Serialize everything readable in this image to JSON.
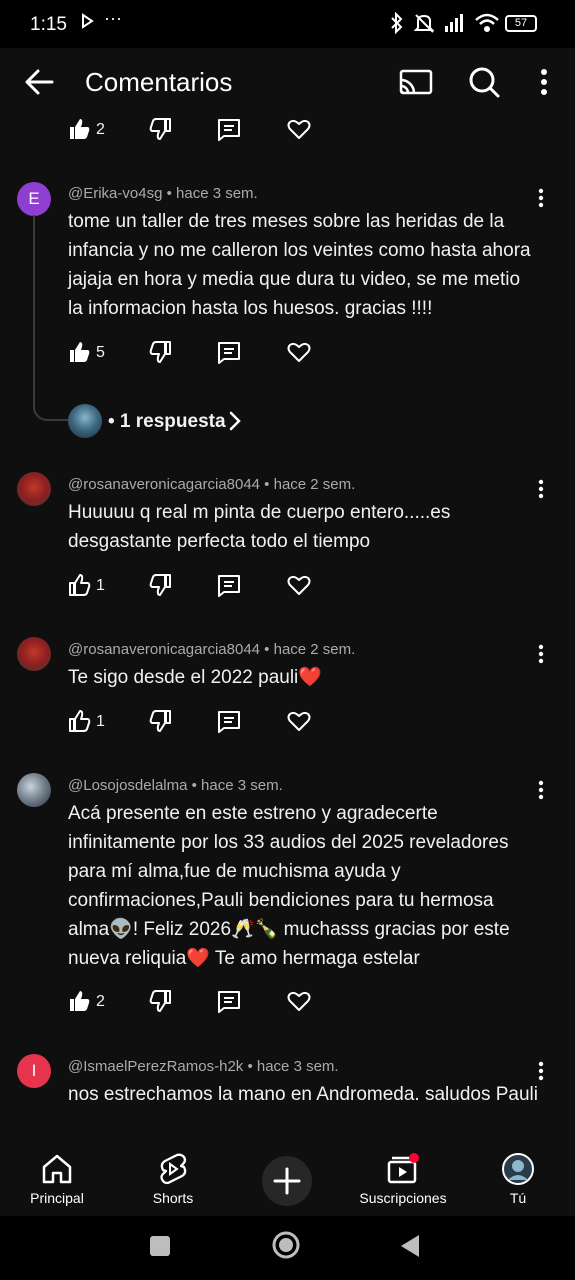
{
  "status_bar": {
    "time": "1:15",
    "battery": "57"
  },
  "header": {
    "title": "Comentarios"
  },
  "top_actions": {
    "likes": "2"
  },
  "comments": [
    {
      "avatar_letter": "E",
      "avatar_color": "#8e3fd1",
      "meta": "@Erika-vo4sg • hace 3 sem.",
      "text": "tome un taller de tres meses sobre las heridas de la infancia y  no me calleron los veintes como hasta ahora jajaja  en hora y media que dura tu video, se me metio la informacion hasta los huesos. gracias !!!!",
      "likes": "5",
      "replies_label": "• 1 respuesta"
    },
    {
      "avatar_letter": "",
      "avatar_color": "#b02a2a",
      "meta": "@rosanaveronicagarcia8044 • hace 2 sem.",
      "text": "Huuuuu q real m pinta de cuerpo entero.....es desgastante perfecta todo el tiempo",
      "likes": "1"
    },
    {
      "avatar_letter": "",
      "avatar_color": "#b02a2a",
      "meta": "@rosanaveronicagarcia8044 • hace 2 sem.",
      "text": "Te sigo desde el 2022 pauli❤️",
      "likes": "1"
    },
    {
      "avatar_letter": "",
      "avatar_color": "#6f7c88",
      "meta": "@Losojosdelalma • hace 3 sem.",
      "text": "Acá presente en este estreno y agradecerte infinitamente por los 33 audios del 2025 reveladores para mí alma,fue de muchisma ayuda y confirmaciones,Pauli bendiciones para tu hermosa alma👽! Feliz 2026🥂🍾 muchasss gracias por este nueva reliquia❤️ Te amo hermaga estelar",
      "likes": "2"
    },
    {
      "avatar_letter": "I",
      "avatar_color": "#e6344f",
      "meta": "@IsmaelPerezRamos-h2k • hace 3 sem.",
      "text": "nos estrechamos la mano en Andromeda. saludos Pauli"
    }
  ],
  "bottom_nav": {
    "home": "Principal",
    "shorts": "Shorts",
    "subscriptions": "Suscripciones",
    "you": "Tú"
  },
  "colors": {
    "background": "#0f0f0f",
    "text": "#f1f1f1",
    "meta": "#aaaaaa",
    "notification": "#ff0033"
  }
}
